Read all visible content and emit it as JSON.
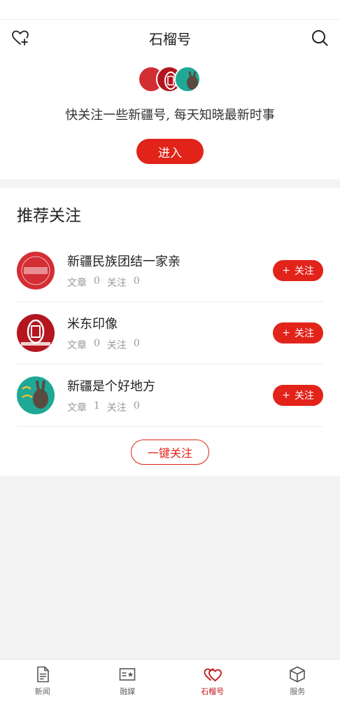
{
  "header": {
    "title": "石榴号"
  },
  "intro": {
    "text": "快关注一些新疆号, 每天知晓最新时事",
    "enter_label": "进入"
  },
  "recommend": {
    "title": "推荐关注",
    "items": [
      {
        "name": "新疆民族团结一家亲",
        "articles_label": "文章",
        "articles": "0",
        "follows_label": "关注",
        "follows": "0",
        "follow_label": "关注",
        "avatar_color": "#d42e35"
      },
      {
        "name": "米东印像",
        "articles_label": "文章",
        "articles": "0",
        "follows_label": "关注",
        "follows": "0",
        "follow_label": "关注",
        "avatar_color": "#b3161f"
      },
      {
        "name": "新疆是个好地方",
        "articles_label": "文章",
        "articles": "1",
        "follows_label": "关注",
        "follows": "0",
        "follow_label": "关注",
        "avatar_color": "#1fa896"
      }
    ],
    "follow_all_label": "一键关注"
  },
  "tabs": [
    {
      "label": "新闻",
      "icon": "document-icon"
    },
    {
      "label": "融媒",
      "icon": "media-card-icon"
    },
    {
      "label": "石榴号",
      "icon": "hearts-icon",
      "active": true
    },
    {
      "label": "服务",
      "icon": "cube-icon"
    }
  ],
  "colors": {
    "accent": "#e2231a",
    "active_tab": "#c0161c"
  }
}
